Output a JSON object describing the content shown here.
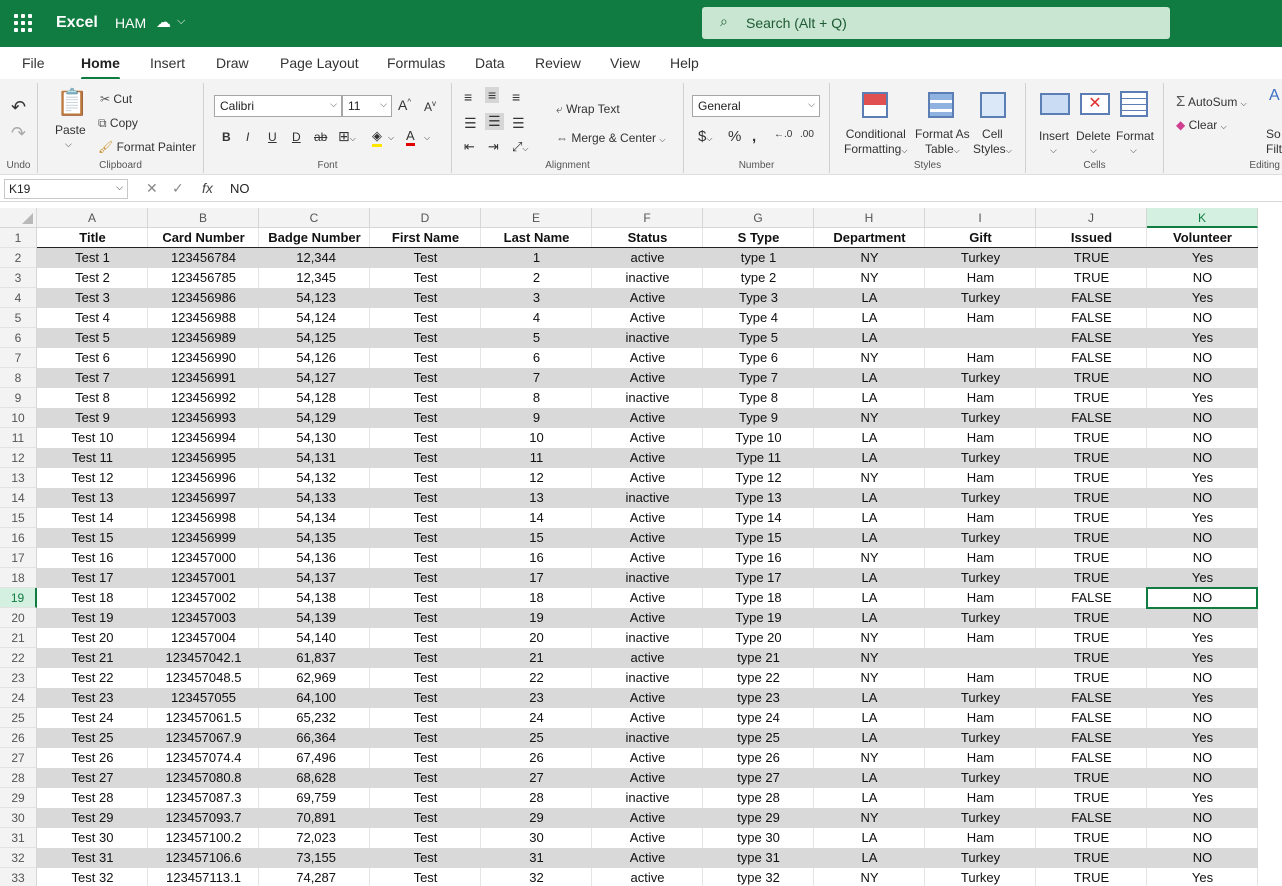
{
  "titlebar": {
    "app_name": "Excel",
    "doc_name": "HAM",
    "search_placeholder": "Search (Alt + Q)"
  },
  "tabs": [
    "File",
    "Home",
    "Insert",
    "Draw",
    "Page Layout",
    "Formulas",
    "Data",
    "Review",
    "View",
    "Help"
  ],
  "ribbon": {
    "undo_label": "Undo",
    "clipboard": {
      "paste": "Paste",
      "cut": "Cut",
      "copy": "Copy",
      "format_painter": "Format Painter",
      "label": "Clipboard"
    },
    "font": {
      "name": "Calibri",
      "size": "11",
      "label": "Font"
    },
    "alignment": {
      "wrap": "Wrap Text",
      "merge": "Merge & Center",
      "label": "Alignment"
    },
    "number": {
      "format": "General",
      "label": "Number"
    },
    "styles": {
      "cond": [
        "Conditional",
        "Formatting"
      ],
      "table": [
        "Format As",
        "Table"
      ],
      "cell": [
        "Cell",
        "Styles"
      ],
      "label": "Styles"
    },
    "cells": {
      "insert": "Insert",
      "delete": "Delete",
      "format": "Format",
      "label": "Cells"
    },
    "editing": {
      "autosum": "AutoSum",
      "clear": "Clear",
      "sort": [
        "So",
        "Filt"
      ],
      "label": "Editing"
    }
  },
  "formula_bar": {
    "cell_ref": "K19",
    "formula": "NO"
  },
  "columns": [
    "A",
    "B",
    "C",
    "D",
    "E",
    "F",
    "G",
    "H",
    "I",
    "J",
    "K"
  ],
  "selected_column": "K",
  "selected_row": 19,
  "headers": [
    "Title",
    "Card Number",
    "Badge Number",
    "First Name",
    "Last Name",
    "Status",
    "S Type",
    "Department",
    "Gift",
    "Issued",
    "Volunteer"
  ],
  "rows": [
    [
      "Test 1",
      "123456784",
      "12,344",
      "Test",
      "1",
      "active",
      "type 1",
      "NY",
      "Turkey",
      "TRUE",
      "Yes"
    ],
    [
      "Test 2",
      "123456785",
      "12,345",
      "Test",
      "2",
      "inactive",
      "type 2",
      "NY",
      "Ham",
      "TRUE",
      "NO"
    ],
    [
      "Test 3",
      "123456986",
      "54,123",
      "Test",
      "3",
      "Active",
      "Type 3",
      "LA",
      "Turkey",
      "FALSE",
      "Yes"
    ],
    [
      "Test 4",
      "123456988",
      "54,124",
      "Test",
      "4",
      "Active",
      "Type 4",
      "LA",
      "Ham",
      "FALSE",
      "NO"
    ],
    [
      "Test 5",
      "123456989",
      "54,125",
      "Test",
      "5",
      "inactive",
      "Type 5",
      "LA",
      "",
      "FALSE",
      "Yes"
    ],
    [
      "Test 6",
      "123456990",
      "54,126",
      "Test",
      "6",
      "Active",
      "Type 6",
      "NY",
      "Ham",
      "FALSE",
      "NO"
    ],
    [
      "Test 7",
      "123456991",
      "54,127",
      "Test",
      "7",
      "Active",
      "Type 7",
      "LA",
      "Turkey",
      "TRUE",
      "NO"
    ],
    [
      "Test 8",
      "123456992",
      "54,128",
      "Test",
      "8",
      "inactive",
      "Type 8",
      "LA",
      "Ham",
      "TRUE",
      "Yes"
    ],
    [
      "Test 9",
      "123456993",
      "54,129",
      "Test",
      "9",
      "Active",
      "Type 9",
      "NY",
      "Turkey",
      "FALSE",
      "NO"
    ],
    [
      "Test 10",
      "123456994",
      "54,130",
      "Test",
      "10",
      "Active",
      "Type 10",
      "LA",
      "Ham",
      "TRUE",
      "NO"
    ],
    [
      "Test 11",
      "123456995",
      "54,131",
      "Test",
      "11",
      "Active",
      "Type 11",
      "LA",
      "Turkey",
      "TRUE",
      "NO"
    ],
    [
      "Test 12",
      "123456996",
      "54,132",
      "Test",
      "12",
      "Active",
      "Type 12",
      "NY",
      "Ham",
      "TRUE",
      "Yes"
    ],
    [
      "Test 13",
      "123456997",
      "54,133",
      "Test",
      "13",
      "inactive",
      "Type 13",
      "LA",
      "Turkey",
      "TRUE",
      "NO"
    ],
    [
      "Test 14",
      "123456998",
      "54,134",
      "Test",
      "14",
      "Active",
      "Type 14",
      "LA",
      "Ham",
      "TRUE",
      "Yes"
    ],
    [
      "Test 15",
      "123456999",
      "54,135",
      "Test",
      "15",
      "Active",
      "Type 15",
      "LA",
      "Turkey",
      "TRUE",
      "NO"
    ],
    [
      "Test 16",
      "123457000",
      "54,136",
      "Test",
      "16",
      "Active",
      "Type 16",
      "NY",
      "Ham",
      "TRUE",
      "NO"
    ],
    [
      "Test 17",
      "123457001",
      "54,137",
      "Test",
      "17",
      "inactive",
      "Type 17",
      "LA",
      "Turkey",
      "TRUE",
      "Yes"
    ],
    [
      "Test 18",
      "123457002",
      "54,138",
      "Test",
      "18",
      "Active",
      "Type 18",
      "LA",
      "Ham",
      "FALSE",
      "NO"
    ],
    [
      "Test 19",
      "123457003",
      "54,139",
      "Test",
      "19",
      "Active",
      "Type 19",
      "LA",
      "Turkey",
      "TRUE",
      "NO"
    ],
    [
      "Test 20",
      "123457004",
      "54,140",
      "Test",
      "20",
      "inactive",
      "Type 20",
      "NY",
      "Ham",
      "TRUE",
      "Yes"
    ],
    [
      "Test 21",
      "123457042.1",
      "61,837",
      "Test",
      "21",
      "active",
      "type 21",
      "NY",
      "",
      "TRUE",
      "Yes"
    ],
    [
      "Test 22",
      "123457048.5",
      "62,969",
      "Test",
      "22",
      "inactive",
      "type 22",
      "NY",
      "Ham",
      "TRUE",
      "NO"
    ],
    [
      "Test 23",
      "123457055",
      "64,100",
      "Test",
      "23",
      "Active",
      "type 23",
      "LA",
      "Turkey",
      "FALSE",
      "Yes"
    ],
    [
      "Test 24",
      "123457061.5",
      "65,232",
      "Test",
      "24",
      "Active",
      "type 24",
      "LA",
      "Ham",
      "FALSE",
      "NO"
    ],
    [
      "Test 25",
      "123457067.9",
      "66,364",
      "Test",
      "25",
      "inactive",
      "type 25",
      "LA",
      "Turkey",
      "FALSE",
      "Yes"
    ],
    [
      "Test 26",
      "123457074.4",
      "67,496",
      "Test",
      "26",
      "Active",
      "type 26",
      "NY",
      "Ham",
      "FALSE",
      "NO"
    ],
    [
      "Test 27",
      "123457080.8",
      "68,628",
      "Test",
      "27",
      "Active",
      "type 27",
      "LA",
      "Turkey",
      "TRUE",
      "NO"
    ],
    [
      "Test 28",
      "123457087.3",
      "69,759",
      "Test",
      "28",
      "inactive",
      "type 28",
      "LA",
      "Ham",
      "TRUE",
      "Yes"
    ],
    [
      "Test 29",
      "123457093.7",
      "70,891",
      "Test",
      "29",
      "Active",
      "type 29",
      "NY",
      "Turkey",
      "FALSE",
      "NO"
    ],
    [
      "Test 30",
      "123457100.2",
      "72,023",
      "Test",
      "30",
      "Active",
      "type 30",
      "LA",
      "Ham",
      "TRUE",
      "NO"
    ],
    [
      "Test 31",
      "123457106.6",
      "73,155",
      "Test",
      "31",
      "Active",
      "type 31",
      "LA",
      "Turkey",
      "TRUE",
      "NO"
    ],
    [
      "Test 32",
      "123457113.1",
      "74,287",
      "Test",
      "32",
      "active",
      "type 32",
      "NY",
      "Turkey",
      "TRUE",
      "Yes"
    ]
  ],
  "colors": {
    "accent": "#107c41",
    "search_bg": "#c8e6d1",
    "row_shade": "#d9d9d9"
  }
}
